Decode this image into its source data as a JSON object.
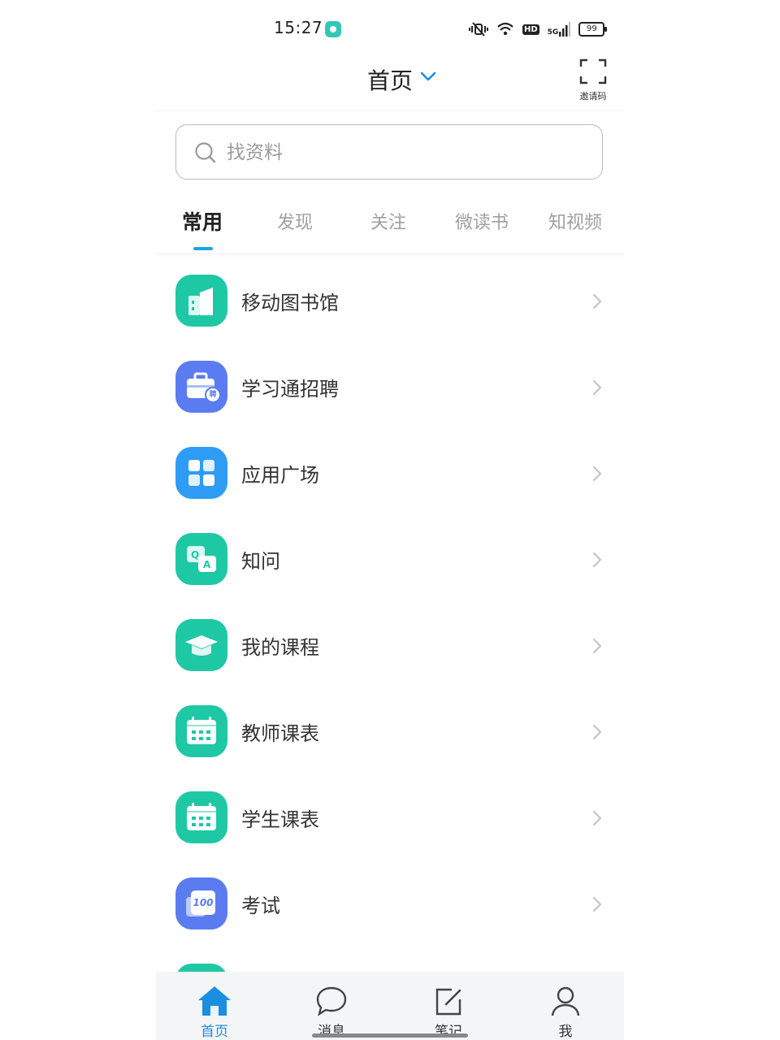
{
  "status_bar": {
    "time": "15:27",
    "hd": "HD",
    "net": "5G",
    "battery": "99"
  },
  "header": {
    "title": "首页",
    "invite_label": "邀请码"
  },
  "search": {
    "placeholder": "找资料"
  },
  "tabs": [
    {
      "label": "常用",
      "active": true
    },
    {
      "label": "发现"
    },
    {
      "label": "关注"
    },
    {
      "label": "微读书"
    },
    {
      "label": "知视频"
    }
  ],
  "list": [
    {
      "label": "移动图书馆",
      "icon": "library-icon",
      "color": "#1ec8a5"
    },
    {
      "label": "学习通招聘",
      "icon": "recruit-briefcase-icon",
      "badge": "聘",
      "color": "#5b7cf0"
    },
    {
      "label": "应用广场",
      "icon": "app-grid-icon",
      "color": "#2e9cf5"
    },
    {
      "label": "知问",
      "icon": "qa-icon",
      "color": "#1ec8a5"
    },
    {
      "label": "我的课程",
      "icon": "graduation-cap-icon",
      "color": "#1ec8a5"
    },
    {
      "label": "教师课表",
      "icon": "calendar-icon",
      "color": "#1ec8a5"
    },
    {
      "label": "学生课表",
      "icon": "calendar-icon",
      "color": "#1ec8a5"
    },
    {
      "label": "考试",
      "icon": "exam-100-icon",
      "badge": "100",
      "color": "#5b7cf0"
    }
  ],
  "nav": [
    {
      "label": "首页",
      "icon": "home-icon",
      "active": true
    },
    {
      "label": "消息",
      "icon": "chat-bubble-icon"
    },
    {
      "label": "笔记",
      "icon": "note-edit-icon"
    },
    {
      "label": "我",
      "icon": "person-icon"
    }
  ],
  "colors": {
    "accent": "#1aa3e8",
    "teal": "#1ec8a5",
    "indigo": "#5b7cf0"
  }
}
